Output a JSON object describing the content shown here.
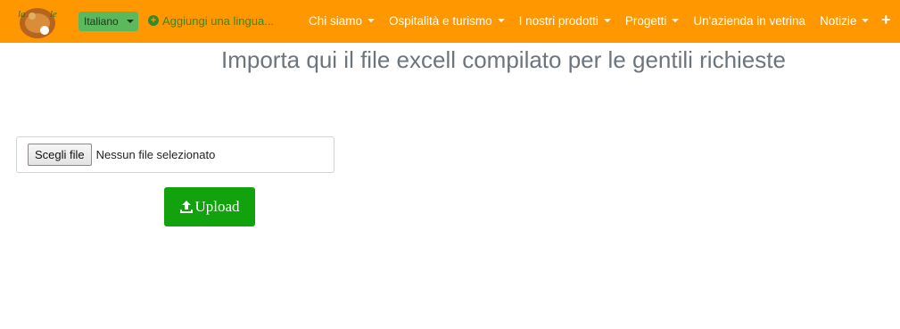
{
  "navbar": {
    "background_color": "#ff9800",
    "logo_icon": "site-logo",
    "language_select": {
      "value": "Italiano",
      "color": "#5cb85c"
    },
    "add_language": {
      "icon": "plus-circle-icon",
      "label": "Aggiungi una lingua..."
    },
    "menu": [
      {
        "label": "Chi siamo",
        "has_dropdown": true
      },
      {
        "label": "Ospitalità e turismo",
        "has_dropdown": true
      },
      {
        "label": "I nostri prodotti",
        "has_dropdown": true
      },
      {
        "label": "Progetti",
        "has_dropdown": true
      },
      {
        "label": "Un'azienda in vetrina",
        "has_dropdown": false
      },
      {
        "label": "Notizie",
        "has_dropdown": true
      }
    ],
    "more_icon": "plus-icon",
    "more_symbol": "+"
  },
  "main": {
    "title": "Importa qui il file excell compilato per le gentili richieste",
    "file_input": {
      "button_label": "Scegli file",
      "status": "Nessun file selezionato"
    },
    "upload_button": {
      "icon": "upload-icon",
      "label": "Upload",
      "color": "#12a20e"
    }
  }
}
